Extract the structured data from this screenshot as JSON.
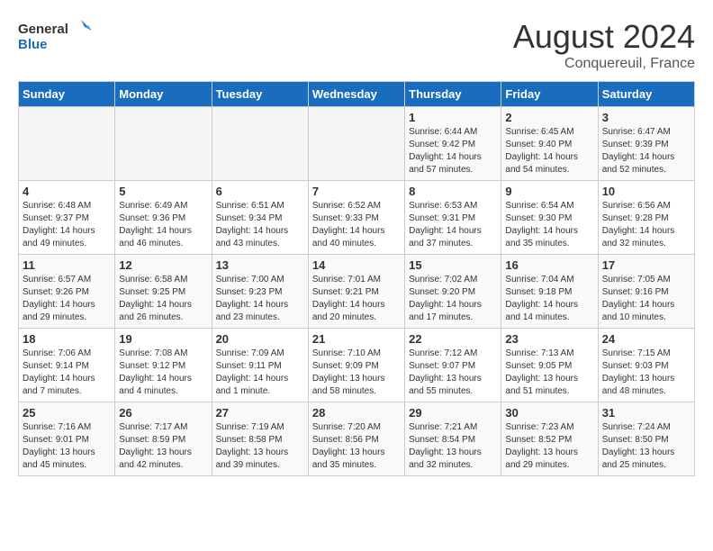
{
  "header": {
    "logo_general": "General",
    "logo_blue": "Blue",
    "month_year": "August 2024",
    "location": "Conquereuil, France"
  },
  "days_of_week": [
    "Sunday",
    "Monday",
    "Tuesday",
    "Wednesday",
    "Thursday",
    "Friday",
    "Saturday"
  ],
  "weeks": [
    [
      {
        "day": "",
        "info": ""
      },
      {
        "day": "",
        "info": ""
      },
      {
        "day": "",
        "info": ""
      },
      {
        "day": "",
        "info": ""
      },
      {
        "day": "1",
        "info": "Sunrise: 6:44 AM\nSunset: 9:42 PM\nDaylight: 14 hours\nand 57 minutes."
      },
      {
        "day": "2",
        "info": "Sunrise: 6:45 AM\nSunset: 9:40 PM\nDaylight: 14 hours\nand 54 minutes."
      },
      {
        "day": "3",
        "info": "Sunrise: 6:47 AM\nSunset: 9:39 PM\nDaylight: 14 hours\nand 52 minutes."
      }
    ],
    [
      {
        "day": "4",
        "info": "Sunrise: 6:48 AM\nSunset: 9:37 PM\nDaylight: 14 hours\nand 49 minutes."
      },
      {
        "day": "5",
        "info": "Sunrise: 6:49 AM\nSunset: 9:36 PM\nDaylight: 14 hours\nand 46 minutes."
      },
      {
        "day": "6",
        "info": "Sunrise: 6:51 AM\nSunset: 9:34 PM\nDaylight: 14 hours\nand 43 minutes."
      },
      {
        "day": "7",
        "info": "Sunrise: 6:52 AM\nSunset: 9:33 PM\nDaylight: 14 hours\nand 40 minutes."
      },
      {
        "day": "8",
        "info": "Sunrise: 6:53 AM\nSunset: 9:31 PM\nDaylight: 14 hours\nand 37 minutes."
      },
      {
        "day": "9",
        "info": "Sunrise: 6:54 AM\nSunset: 9:30 PM\nDaylight: 14 hours\nand 35 minutes."
      },
      {
        "day": "10",
        "info": "Sunrise: 6:56 AM\nSunset: 9:28 PM\nDaylight: 14 hours\nand 32 minutes."
      }
    ],
    [
      {
        "day": "11",
        "info": "Sunrise: 6:57 AM\nSunset: 9:26 PM\nDaylight: 14 hours\nand 29 minutes."
      },
      {
        "day": "12",
        "info": "Sunrise: 6:58 AM\nSunset: 9:25 PM\nDaylight: 14 hours\nand 26 minutes."
      },
      {
        "day": "13",
        "info": "Sunrise: 7:00 AM\nSunset: 9:23 PM\nDaylight: 14 hours\nand 23 minutes."
      },
      {
        "day": "14",
        "info": "Sunrise: 7:01 AM\nSunset: 9:21 PM\nDaylight: 14 hours\nand 20 minutes."
      },
      {
        "day": "15",
        "info": "Sunrise: 7:02 AM\nSunset: 9:20 PM\nDaylight: 14 hours\nand 17 minutes."
      },
      {
        "day": "16",
        "info": "Sunrise: 7:04 AM\nSunset: 9:18 PM\nDaylight: 14 hours\nand 14 minutes."
      },
      {
        "day": "17",
        "info": "Sunrise: 7:05 AM\nSunset: 9:16 PM\nDaylight: 14 hours\nand 10 minutes."
      }
    ],
    [
      {
        "day": "18",
        "info": "Sunrise: 7:06 AM\nSunset: 9:14 PM\nDaylight: 14 hours\nand 7 minutes."
      },
      {
        "day": "19",
        "info": "Sunrise: 7:08 AM\nSunset: 9:12 PM\nDaylight: 14 hours\nand 4 minutes."
      },
      {
        "day": "20",
        "info": "Sunrise: 7:09 AM\nSunset: 9:11 PM\nDaylight: 14 hours\nand 1 minute."
      },
      {
        "day": "21",
        "info": "Sunrise: 7:10 AM\nSunset: 9:09 PM\nDaylight: 13 hours\nand 58 minutes."
      },
      {
        "day": "22",
        "info": "Sunrise: 7:12 AM\nSunset: 9:07 PM\nDaylight: 13 hours\nand 55 minutes."
      },
      {
        "day": "23",
        "info": "Sunrise: 7:13 AM\nSunset: 9:05 PM\nDaylight: 13 hours\nand 51 minutes."
      },
      {
        "day": "24",
        "info": "Sunrise: 7:15 AM\nSunset: 9:03 PM\nDaylight: 13 hours\nand 48 minutes."
      }
    ],
    [
      {
        "day": "25",
        "info": "Sunrise: 7:16 AM\nSunset: 9:01 PM\nDaylight: 13 hours\nand 45 minutes."
      },
      {
        "day": "26",
        "info": "Sunrise: 7:17 AM\nSunset: 8:59 PM\nDaylight: 13 hours\nand 42 minutes."
      },
      {
        "day": "27",
        "info": "Sunrise: 7:19 AM\nSunset: 8:58 PM\nDaylight: 13 hours\nand 39 minutes."
      },
      {
        "day": "28",
        "info": "Sunrise: 7:20 AM\nSunset: 8:56 PM\nDaylight: 13 hours\nand 35 minutes."
      },
      {
        "day": "29",
        "info": "Sunrise: 7:21 AM\nSunset: 8:54 PM\nDaylight: 13 hours\nand 32 minutes."
      },
      {
        "day": "30",
        "info": "Sunrise: 7:23 AM\nSunset: 8:52 PM\nDaylight: 13 hours\nand 29 minutes."
      },
      {
        "day": "31",
        "info": "Sunrise: 7:24 AM\nSunset: 8:50 PM\nDaylight: 13 hours\nand 25 minutes."
      }
    ]
  ]
}
